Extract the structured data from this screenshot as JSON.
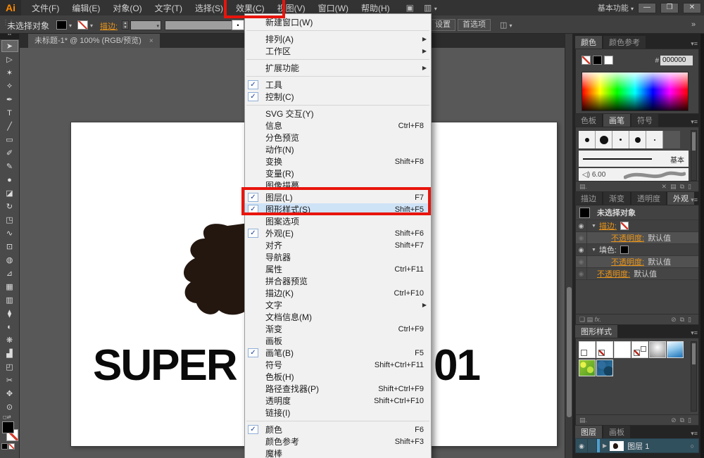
{
  "window": {
    "workspace": "基本功能",
    "minimize": "—",
    "restore": "❐",
    "close": "✕"
  },
  "menubar": {
    "logo": "Ai",
    "items": [
      "文件(F)",
      "编辑(E)",
      "对象(O)",
      "文字(T)",
      "选择(S)",
      "效果(C)",
      "视图(V)",
      "窗口(W)",
      "帮助(H)"
    ]
  },
  "controlbar": {
    "status": "未选择对象",
    "stroke_label": "描边:",
    "bullet": "•",
    "settings_button": "设置",
    "preferences_button": "首选项"
  },
  "document_tab": {
    "title": "未标题-1* @ 100% (RGB/预览)",
    "close": "×"
  },
  "canvas": {
    "text_left": "SUPER",
    "text_right": "01"
  },
  "icons": {
    "check": "✓",
    "submenu": "▶",
    "dropdown": "▾",
    "panel_menu": "▾≡",
    "eye": "◉",
    "target": "○",
    "caret": "▼",
    "expand": "▶",
    "bridge": "▣",
    "arrange": "▥",
    "collapse": "»",
    "grip": "⋮⋮",
    "stepper": "▲▼",
    "library": "▤.",
    "fx": "fx.",
    "clear": "⊘",
    "new": "⧉",
    "trash": "▯",
    "square": "❑",
    "list": "▤",
    "cut": "✕",
    "reset": "◻⇄",
    "tab_head": "▪▪"
  },
  "toolbar": {
    "tools": [
      {
        "name": "selection",
        "glyph": "➤"
      },
      {
        "name": "direct-selection",
        "glyph": "▷"
      },
      {
        "name": "magic-wand",
        "glyph": "✶"
      },
      {
        "name": "lasso",
        "glyph": "⟡"
      },
      {
        "name": "pen",
        "glyph": "✒"
      },
      {
        "name": "type",
        "glyph": "T"
      },
      {
        "name": "line-segment",
        "glyph": "╱"
      },
      {
        "name": "rectangle",
        "glyph": "▭"
      },
      {
        "name": "paintbrush",
        "glyph": "✐"
      },
      {
        "name": "pencil",
        "glyph": "✎"
      },
      {
        "name": "blob-brush",
        "glyph": "●"
      },
      {
        "name": "eraser",
        "glyph": "◪"
      },
      {
        "name": "rotate",
        "glyph": "↻"
      },
      {
        "name": "scale",
        "glyph": "◳"
      },
      {
        "name": "width",
        "glyph": "∿"
      },
      {
        "name": "free-transform",
        "glyph": "⊡"
      },
      {
        "name": "shape-builder",
        "glyph": "◍"
      },
      {
        "name": "perspective-grid",
        "glyph": "⊿"
      },
      {
        "name": "mesh",
        "glyph": "▦"
      },
      {
        "name": "gradient",
        "glyph": "▥"
      },
      {
        "name": "eyedropper",
        "glyph": "⧫"
      },
      {
        "name": "blend",
        "glyph": "◐"
      },
      {
        "name": "symbol-sprayer",
        "glyph": "❋"
      },
      {
        "name": "column-graph",
        "glyph": "▟"
      },
      {
        "name": "artboard",
        "glyph": "◰"
      },
      {
        "name": "slice",
        "glyph": "✂"
      },
      {
        "name": "hand",
        "glyph": "✥"
      },
      {
        "name": "zoom",
        "glyph": "⊙"
      }
    ]
  },
  "window_menu": {
    "items": [
      {
        "label": "新建窗口(W)"
      },
      {
        "sep": true
      },
      {
        "label": "排列(A)",
        "submenu": true
      },
      {
        "label": "工作区",
        "submenu": true
      },
      {
        "sep": true
      },
      {
        "label": "扩展功能",
        "submenu": true
      },
      {
        "sep": true
      },
      {
        "label": "工具",
        "checked": true
      },
      {
        "label": "控制(C)",
        "checked": true
      },
      {
        "sep": true
      },
      {
        "label": "SVG 交互(Y)"
      },
      {
        "label": "信息",
        "shortcut": "Ctrl+F8"
      },
      {
        "label": "分色预览"
      },
      {
        "label": "动作(N)"
      },
      {
        "label": "变换",
        "shortcut": "Shift+F8"
      },
      {
        "label": "变量(R)"
      },
      {
        "label": "图像描摹"
      },
      {
        "label": "图层(L)",
        "shortcut": "F7",
        "checked": true
      },
      {
        "label": "图形样式(S)",
        "shortcut": "Shift+F5",
        "checked": true,
        "highlighted": true
      },
      {
        "label": "图案选项"
      },
      {
        "label": "外观(E)",
        "shortcut": "Shift+F6",
        "checked": true
      },
      {
        "label": "对齐",
        "shortcut": "Shift+F7"
      },
      {
        "label": "导航器"
      },
      {
        "label": "属性",
        "shortcut": "Ctrl+F11"
      },
      {
        "label": "拼合器预览"
      },
      {
        "label": "描边(K)",
        "shortcut": "Ctrl+F10"
      },
      {
        "label": "文字",
        "submenu": true
      },
      {
        "label": "文档信息(M)"
      },
      {
        "label": "渐变",
        "shortcut": "Ctrl+F9"
      },
      {
        "label": "画板"
      },
      {
        "label": "画笔(B)",
        "shortcut": "F5",
        "checked": true
      },
      {
        "label": "符号",
        "shortcut": "Shift+Ctrl+F11"
      },
      {
        "label": "色板(H)"
      },
      {
        "label": "路径查找器(P)",
        "shortcut": "Shift+Ctrl+F9"
      },
      {
        "label": "透明度",
        "shortcut": "Shift+Ctrl+F10"
      },
      {
        "label": "链接(I)"
      },
      {
        "sep": true
      },
      {
        "label": "颜色",
        "shortcut": "F6",
        "checked": true
      },
      {
        "label": "颜色参考",
        "shortcut": "Shift+F3"
      },
      {
        "label": "魔棒"
      }
    ]
  },
  "panels": {
    "color": {
      "tabs": [
        "颜色",
        "颜色参考"
      ],
      "active": "颜色",
      "hex_prefix": "#",
      "hex_value": "000000"
    },
    "brushes": {
      "tabs": [
        "色板",
        "画笔",
        "符号"
      ],
      "active": "画笔",
      "dot_sizes": [
        6,
        12,
        3,
        8,
        2
      ],
      "basic_label": "基本",
      "art_brush_size": "6.00"
    },
    "appearance": {
      "tabs": [
        "描边",
        "渐变",
        "透明度",
        "外观"
      ],
      "active": "外观",
      "rows": [
        {
          "type": "hdr",
          "label": "未选择对象",
          "swatch": "black"
        },
        {
          "type": "attr",
          "label": "描边:",
          "link": true,
          "swatch": "none"
        },
        {
          "type": "subr",
          "label": "不透明度:",
          "value": "默认值"
        },
        {
          "type": "attr",
          "label": "填色:",
          "link": false,
          "swatch": "black"
        },
        {
          "type": "subr",
          "label": "不透明度:",
          "value": "默认值"
        },
        {
          "type": "sub2",
          "label": "不透明度:",
          "value": "默认值"
        }
      ]
    },
    "graphic_styles": {
      "title": "图形样式",
      "thumbs": [
        "default",
        "no-fill",
        "plain",
        "double",
        "gray-gradient",
        "blue-gradient",
        "green-organic",
        "blue-pattern"
      ]
    },
    "layers": {
      "tabs": [
        "图层",
        "画板"
      ],
      "active": "图层",
      "layer_name": "图层 1"
    }
  },
  "colors": {
    "annotation_red": "#e8150d",
    "accent_orange": "#e8941a",
    "blob_fill": "#241710",
    "check_blue": "#1d3f9e"
  }
}
